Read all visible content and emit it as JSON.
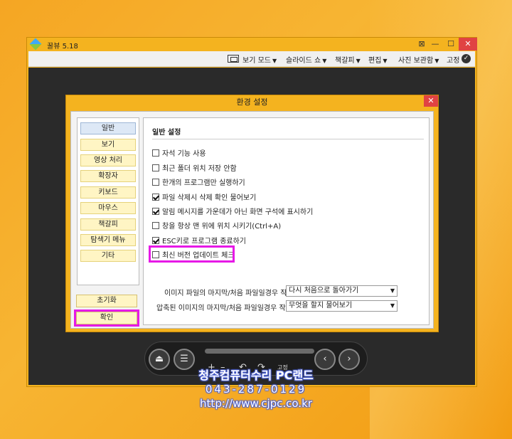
{
  "app": {
    "title": "꿀뷰 5.18",
    "window_buttons": {
      "pin": "⊠",
      "minimize": "—",
      "maximize": "☐",
      "close": "✕"
    }
  },
  "menubar": {
    "items": [
      {
        "label": "보기 모드"
      },
      {
        "label": "슬라이드 쇼"
      },
      {
        "label": "책갈피"
      },
      {
        "label": "편집"
      },
      {
        "label": "사진 보관함"
      }
    ],
    "pin_label": "고정"
  },
  "dialog": {
    "title": "환경 설정",
    "close": "✕",
    "sidebar": {
      "items": [
        {
          "label": "일반",
          "active": true
        },
        {
          "label": "보기"
        },
        {
          "label": "영상 처리"
        },
        {
          "label": "확장자"
        },
        {
          "label": "키보드"
        },
        {
          "label": "마우스"
        },
        {
          "label": "책갈피"
        },
        {
          "label": "탐색기 메뉴"
        },
        {
          "label": "기타"
        }
      ],
      "reset_label": "초기화",
      "ok_label": "확인"
    },
    "general": {
      "section_title": "일반 설정",
      "options": [
        {
          "label": "자석 기능 사용",
          "checked": false
        },
        {
          "label": "최근 폴더 위치 저장 안함",
          "checked": false
        },
        {
          "label": "한개의 프로그램만 실행하기",
          "checked": false
        },
        {
          "label": "파일 삭제시 삭제 확인 물어보기",
          "checked": true
        },
        {
          "label": "알림 메시지를 가운데가 아닌 화면 구석에 표시하기",
          "checked": true
        },
        {
          "label": "창을 항상 맨 위에 위치 시키기(Ctrl+A)",
          "checked": false
        },
        {
          "label": "ESC키로 프로그램 종료하기",
          "checked": true
        },
        {
          "label": "최신 버전 업데이트 체크",
          "checked": false
        }
      ],
      "last_image_label": "이미지 파일의 마지막/처음 파일일경우 작동:",
      "last_image_value": "다시 처음으로 돌아가기",
      "archive_label": "압축된 이미지의 마지막/처음 파일일경우 작동:",
      "archive_value": "무엇을 할지 물어보기"
    }
  },
  "controls": {
    "eject": "⏏",
    "menu": "☰",
    "plus": "+",
    "minus": "–",
    "rotate_left": "↶",
    "rotate_right": "↷",
    "pin_label": "고정",
    "prev": "‹",
    "next": "›"
  },
  "watermark": {
    "line1": "청주컴퓨터수리 PC랜드",
    "line2": "043-287-0129",
    "line3": "http://www.cjpc.co.kr"
  },
  "colors": {
    "accent_window": "#f4b31f",
    "highlight": "#e619e6",
    "close_red": "#e04343"
  }
}
